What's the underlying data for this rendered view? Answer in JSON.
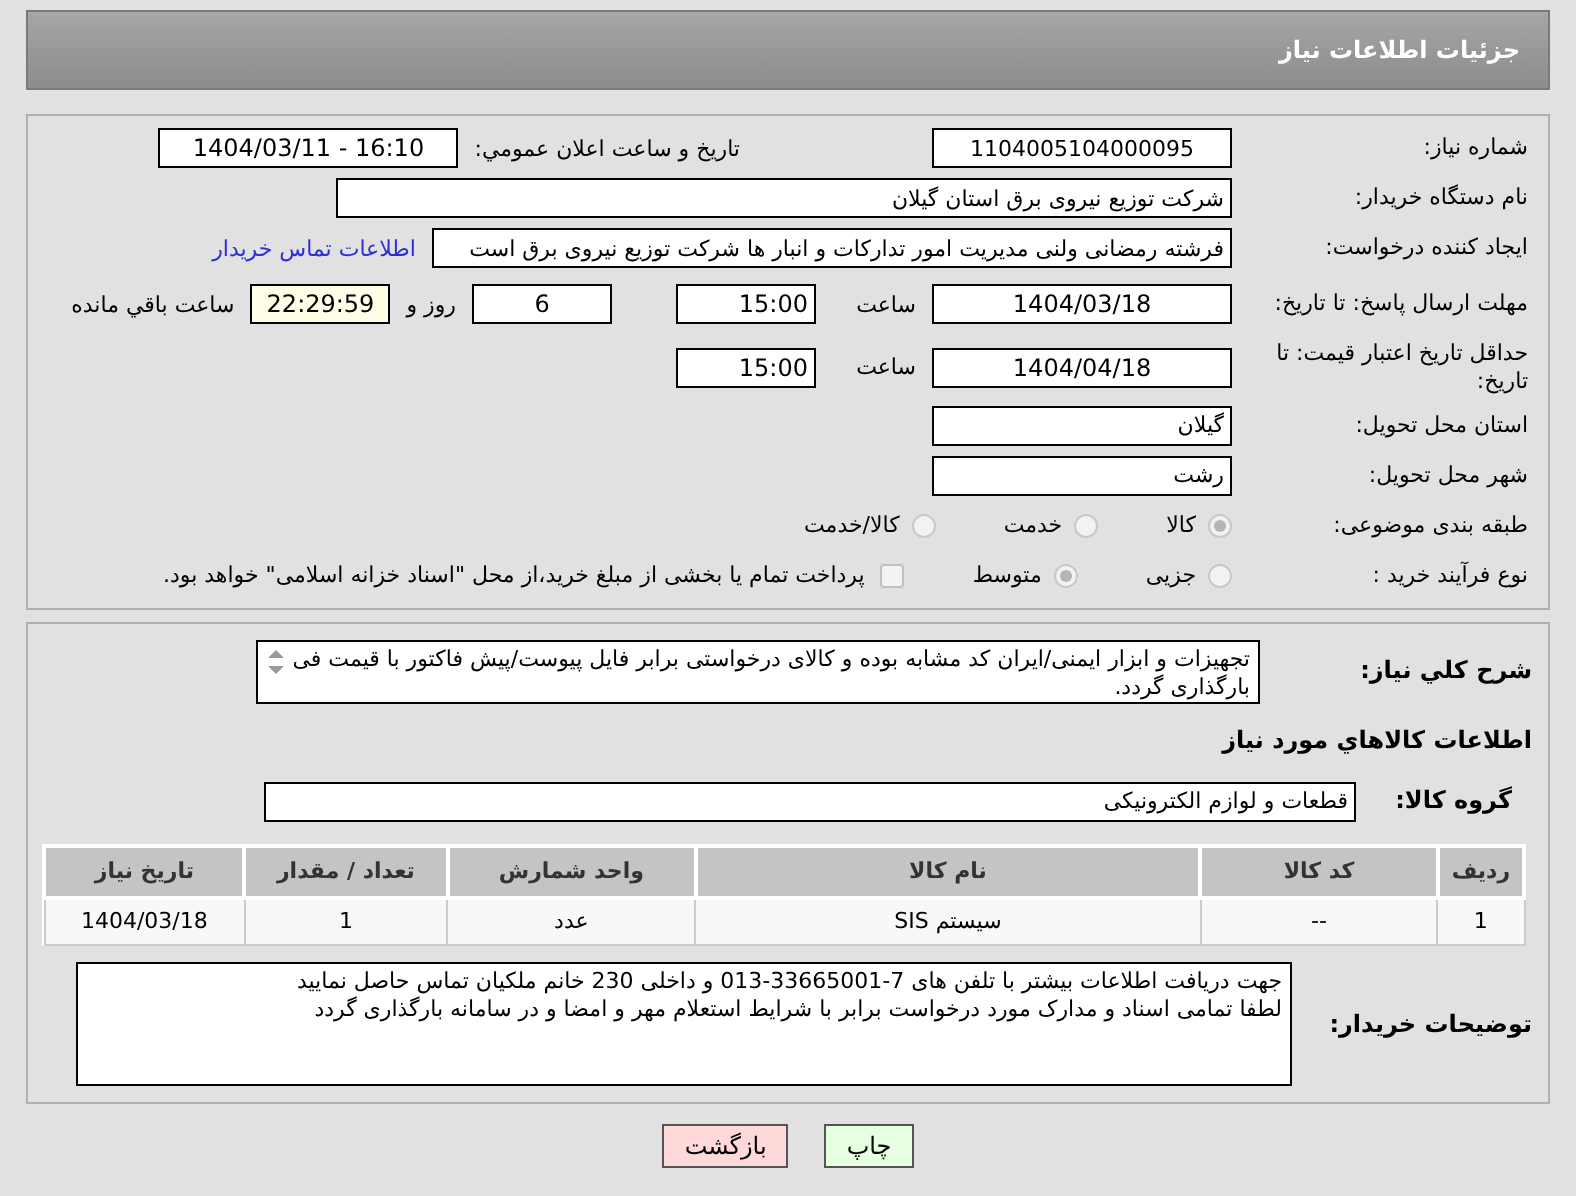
{
  "header": {
    "title": "جزئیات اطلاعات نیاز"
  },
  "need_number": {
    "label": "شماره نیاز:",
    "value": "1104005104000095"
  },
  "announce": {
    "label": "تاریخ و ساعت اعلان عمومي:",
    "value": "1404/03/11 - 16:10"
  },
  "buyer_org": {
    "label": "نام دستگاه خریدار:",
    "value": "شرکت توزیع نیروی برق استان گیلان"
  },
  "creator": {
    "label": "ایجاد کننده درخواست:",
    "value": "فرشته رمضانی ولنی مدیریت امور تدارکات و انبار ها شرکت توزیع نیروی برق است",
    "link": "اطلاعات تماس خریدار"
  },
  "deadline": {
    "label": "مهلت ارسال پاسخ: تا تاریخ:",
    "date": "1404/03/18",
    "time_label": "ساعت",
    "time": "15:00",
    "days": "6",
    "days_label": "روز و",
    "remaining": "22:29:59",
    "remaining_label": "ساعت باقي مانده"
  },
  "validity": {
    "label": "حداقل تاریخ اعتبار قیمت: تا تاریخ:",
    "date": "1404/04/18",
    "time_label": "ساعت",
    "time": "15:00"
  },
  "province": {
    "label": "استان محل تحویل:",
    "value": "گیلان"
  },
  "city": {
    "label": "شهر محل تحویل:",
    "value": "رشت"
  },
  "category": {
    "label": "طبقه بندی موضوعی:",
    "options": [
      {
        "label": "کالا",
        "selected": true
      },
      {
        "label": "خدمت",
        "selected": false
      },
      {
        "label": "کالا/خدمت",
        "selected": false
      }
    ]
  },
  "process": {
    "label": "نوع فرآیند خرید :",
    "options": [
      {
        "label": "جزیی",
        "selected": false
      },
      {
        "label": "متوسط",
        "selected": true
      }
    ],
    "treasury": {
      "label": "پرداخت تمام یا بخشی از مبلغ خرید،از محل \"اسناد خزانه اسلامی\" خواهد بود.",
      "checked": false
    }
  },
  "description": {
    "label": "شرح کلي نیاز:",
    "value": "تجهیزات و ابزار ایمنی/ایران کد مشابه بوده و کالای درخواستی برابر فایل پیوست/پیش فاکتور با قیمت فی بارگذاری گردد."
  },
  "goods_heading": "اطلاعات کالاهاي مورد نیاز",
  "goods_group": {
    "label": "گروه کالا:",
    "value": "قطعات و لوازم الکترونیکی"
  },
  "table": {
    "columns": [
      "ردیف",
      "کد کالا",
      "نام کالا",
      "واحد شمارش",
      "تعداد / مقدار",
      "تاریخ نیاز"
    ],
    "rows": [
      [
        "1",
        "--",
        "سیستم SIS",
        "عدد",
        "1",
        "1404/03/18"
      ]
    ]
  },
  "buyer_notes": {
    "label": "توضیحات خریدار:",
    "lines": [
      "جهت دریافت اطلاعات بیشتر با تلفن های 7-33665001-013 و داخلی 230 خانم ملکیان تماس حاصل نمایید",
      "لطفا تمامی اسناد و مدارک مورد درخواست برابر با شرایط استعلام مهر و امضا و در سامانه بارگذاری گردد"
    ]
  },
  "buttons": [
    {
      "label": "چاپ",
      "kind": "print"
    },
    {
      "label": "بازگشت",
      "kind": "back"
    }
  ]
}
